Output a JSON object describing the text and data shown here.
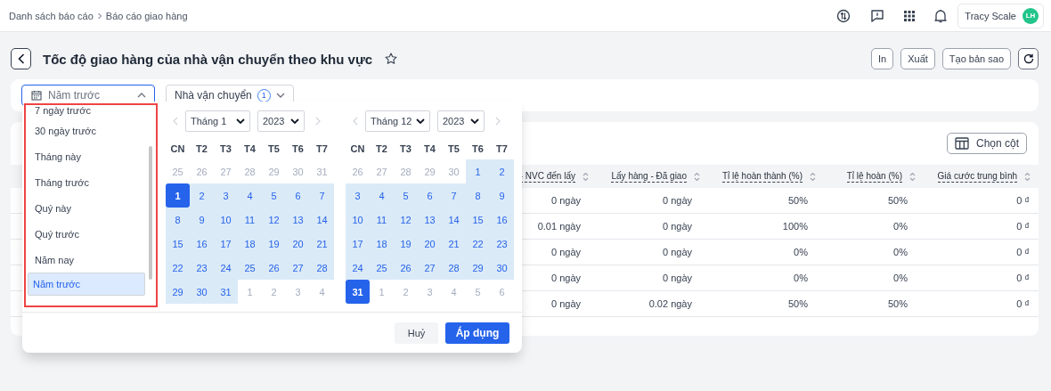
{
  "breadcrumb": [
    "Danh sách báo cáo",
    "Báo cáo giao hàng"
  ],
  "user": {
    "name": "Tracy Scale",
    "initials": "LH"
  },
  "page": {
    "title": "Tốc độ giao hàng của nhà vận chuyển theo khu vực",
    "actions": [
      "In",
      "Xuất",
      "Tạo bản sao"
    ]
  },
  "filters": {
    "date_range": {
      "value": "Năm trước",
      "expanded": true
    },
    "carrier": {
      "label": "Nhà vận chuyển",
      "count": "1"
    }
  },
  "date_popup": {
    "presets": [
      {
        "label": "7 ngày trước",
        "selected": false
      },
      {
        "label": "30 ngày trước",
        "selected": false
      },
      {
        "label": "Tháng này",
        "selected": false
      },
      {
        "label": "Tháng trước",
        "selected": false
      },
      {
        "label": "Quý này",
        "selected": false
      },
      {
        "label": "Quý trước",
        "selected": false
      },
      {
        "label": "Năm nay",
        "selected": false
      },
      {
        "label": "Năm trước",
        "selected": true
      }
    ],
    "calendars": [
      {
        "month": "Tháng 1",
        "year": "2023",
        "weekdays": [
          "CN",
          "T2",
          "T3",
          "T4",
          "T5",
          "T6",
          "T7"
        ],
        "days": [
          {
            "label": "25",
            "kind": "outside"
          },
          {
            "label": "26",
            "kind": "outside"
          },
          {
            "label": "27",
            "kind": "outside"
          },
          {
            "label": "28",
            "kind": "outside"
          },
          {
            "label": "29",
            "kind": "outside"
          },
          {
            "label": "30",
            "kind": "outside"
          },
          {
            "label": "31",
            "kind": "outside"
          },
          {
            "label": "1",
            "kind": "endpoint"
          },
          {
            "label": "2",
            "kind": "range"
          },
          {
            "label": "3",
            "kind": "range"
          },
          {
            "label": "4",
            "kind": "range"
          },
          {
            "label": "5",
            "kind": "range"
          },
          {
            "label": "6",
            "kind": "range"
          },
          {
            "label": "7",
            "kind": "range"
          },
          {
            "label": "8",
            "kind": "range"
          },
          {
            "label": "9",
            "kind": "range"
          },
          {
            "label": "10",
            "kind": "range"
          },
          {
            "label": "11",
            "kind": "range"
          },
          {
            "label": "12",
            "kind": "range"
          },
          {
            "label": "13",
            "kind": "range"
          },
          {
            "label": "14",
            "kind": "range"
          },
          {
            "label": "15",
            "kind": "range"
          },
          {
            "label": "16",
            "kind": "range"
          },
          {
            "label": "17",
            "kind": "range"
          },
          {
            "label": "18",
            "kind": "range"
          },
          {
            "label": "19",
            "kind": "range"
          },
          {
            "label": "20",
            "kind": "range"
          },
          {
            "label": "21",
            "kind": "range"
          },
          {
            "label": "22",
            "kind": "range"
          },
          {
            "label": "23",
            "kind": "range"
          },
          {
            "label": "24",
            "kind": "range"
          },
          {
            "label": "25",
            "kind": "range"
          },
          {
            "label": "26",
            "kind": "range"
          },
          {
            "label": "27",
            "kind": "range"
          },
          {
            "label": "28",
            "kind": "range"
          },
          {
            "label": "29",
            "kind": "range"
          },
          {
            "label": "30",
            "kind": "range"
          },
          {
            "label": "31",
            "kind": "range"
          },
          {
            "label": "1",
            "kind": "outside"
          },
          {
            "label": "2",
            "kind": "outside"
          },
          {
            "label": "3",
            "kind": "outside"
          },
          {
            "label": "4",
            "kind": "outside"
          }
        ]
      },
      {
        "month": "Tháng 12",
        "year": "2023",
        "weekdays": [
          "CN",
          "T2",
          "T3",
          "T4",
          "T5",
          "T6",
          "T7"
        ],
        "days": [
          {
            "label": "26",
            "kind": "outside"
          },
          {
            "label": "27",
            "kind": "outside"
          },
          {
            "label": "28",
            "kind": "outside"
          },
          {
            "label": "29",
            "kind": "outside"
          },
          {
            "label": "30",
            "kind": "outside"
          },
          {
            "label": "1",
            "kind": "range"
          },
          {
            "label": "2",
            "kind": "range"
          },
          {
            "label": "3",
            "kind": "range"
          },
          {
            "label": "4",
            "kind": "range"
          },
          {
            "label": "5",
            "kind": "range"
          },
          {
            "label": "6",
            "kind": "range"
          },
          {
            "label": "7",
            "kind": "range"
          },
          {
            "label": "8",
            "kind": "range"
          },
          {
            "label": "9",
            "kind": "range"
          },
          {
            "label": "10",
            "kind": "range"
          },
          {
            "label": "11",
            "kind": "range"
          },
          {
            "label": "12",
            "kind": "range"
          },
          {
            "label": "13",
            "kind": "range"
          },
          {
            "label": "14",
            "kind": "range"
          },
          {
            "label": "15",
            "kind": "range"
          },
          {
            "label": "16",
            "kind": "range"
          },
          {
            "label": "17",
            "kind": "range"
          },
          {
            "label": "18",
            "kind": "range"
          },
          {
            "label": "19",
            "kind": "range"
          },
          {
            "label": "20",
            "kind": "range"
          },
          {
            "label": "21",
            "kind": "range"
          },
          {
            "label": "22",
            "kind": "range"
          },
          {
            "label": "23",
            "kind": "range"
          },
          {
            "label": "24",
            "kind": "range"
          },
          {
            "label": "25",
            "kind": "range"
          },
          {
            "label": "26",
            "kind": "range"
          },
          {
            "label": "27",
            "kind": "range"
          },
          {
            "label": "28",
            "kind": "range"
          },
          {
            "label": "29",
            "kind": "range"
          },
          {
            "label": "30",
            "kind": "range"
          },
          {
            "label": "31",
            "kind": "endpoint"
          },
          {
            "label": "1",
            "kind": "outside"
          },
          {
            "label": "2",
            "kind": "outside"
          },
          {
            "label": "3",
            "kind": "outside"
          },
          {
            "label": "4",
            "kind": "outside"
          },
          {
            "label": "5",
            "kind": "outside"
          },
          {
            "label": "6",
            "kind": "outside"
          }
        ]
      }
    ],
    "buttons": {
      "cancel": "Huỷ",
      "apply": "Áp dụng"
    }
  },
  "table": {
    "column_picker": "Chọn cột",
    "columns": [
      "- NVC đến lấy",
      "Lấy hàng - Đã giao",
      "Tỉ lệ hoàn thành (%)",
      "Tỉ lệ hoàn (%)",
      "Giá cước trung bình"
    ],
    "rows": [
      [
        "0 ngày",
        "0 ngày",
        "50%",
        "50%",
        "0 ₫"
      ],
      [
        "0.01 ngày",
        "0 ngày",
        "100%",
        "0%",
        "0 ₫"
      ],
      [
        "0 ngày",
        "0 ngày",
        "0%",
        "0%",
        "0 ₫"
      ],
      [
        "0 ngày",
        "0 ngày",
        "0%",
        "0%",
        "0 ₫"
      ],
      [
        "0 ngày",
        "0.02 ngày",
        "50%",
        "50%",
        "0 ₫"
      ]
    ]
  }
}
